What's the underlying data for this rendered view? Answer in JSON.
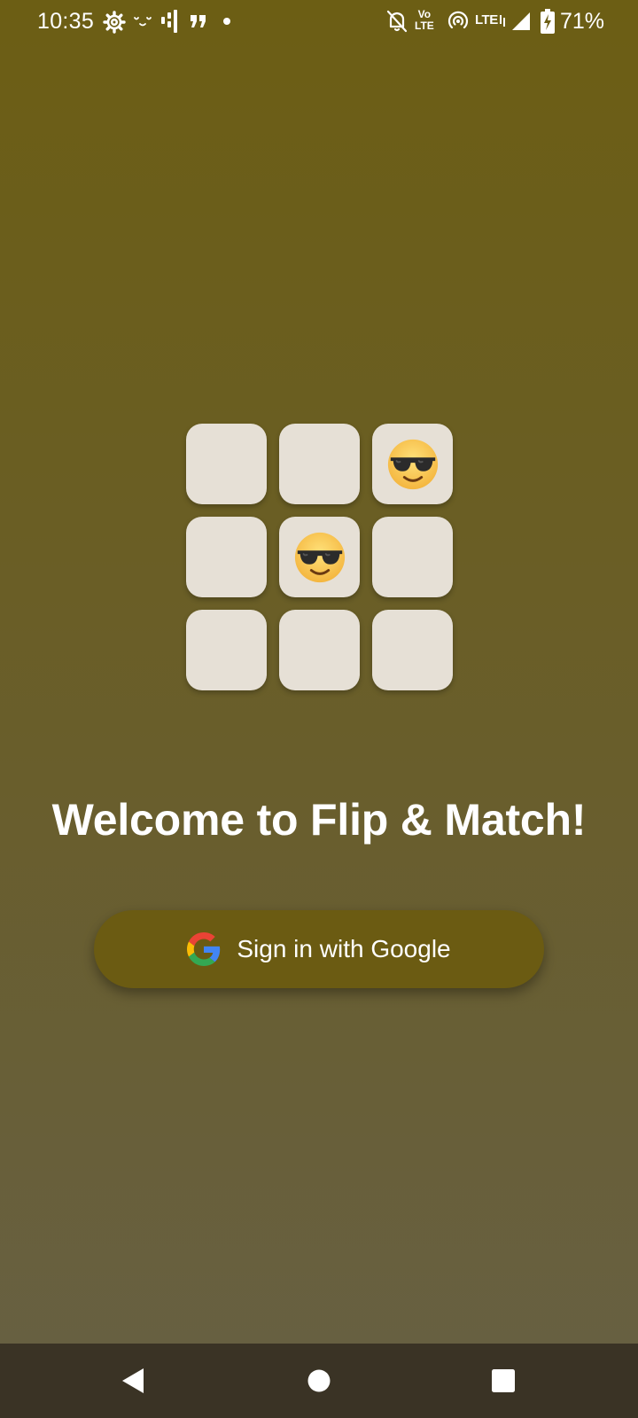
{
  "status_bar": {
    "time": "10:35",
    "volte_top": "Vo",
    "volte_bottom": "LTE",
    "lte": "LTE",
    "battery_percent": "71%",
    "icons": [
      "settings-gear-icon",
      "face-notification-icon",
      "bars-app-icon",
      "quote-app-icon",
      "more-notifications-dot-icon",
      "bell-off-icon",
      "volte-icon",
      "hotspot-icon",
      "lte-icon",
      "signal-icon",
      "battery-charging-icon"
    ]
  },
  "grid": {
    "cards": [
      {
        "face": ""
      },
      {
        "face": ""
      },
      {
        "face": "😎"
      },
      {
        "face": ""
      },
      {
        "face": "😎"
      },
      {
        "face": ""
      },
      {
        "face": ""
      },
      {
        "face": ""
      },
      {
        "face": ""
      }
    ]
  },
  "welcome": {
    "title": "Welcome to Flip & Match!"
  },
  "signin": {
    "label": "Sign in with Google",
    "icon": "google-g-icon"
  },
  "nav_bar": {
    "icons": [
      "back-icon",
      "home-icon",
      "recents-icon"
    ]
  },
  "colors": {
    "background_top": "#6c5e14",
    "background_bottom": "#676044",
    "card": "#e6e0d6",
    "button": "#6b5b12",
    "nav_bar": "#3a3325",
    "text": "#ffffff"
  }
}
